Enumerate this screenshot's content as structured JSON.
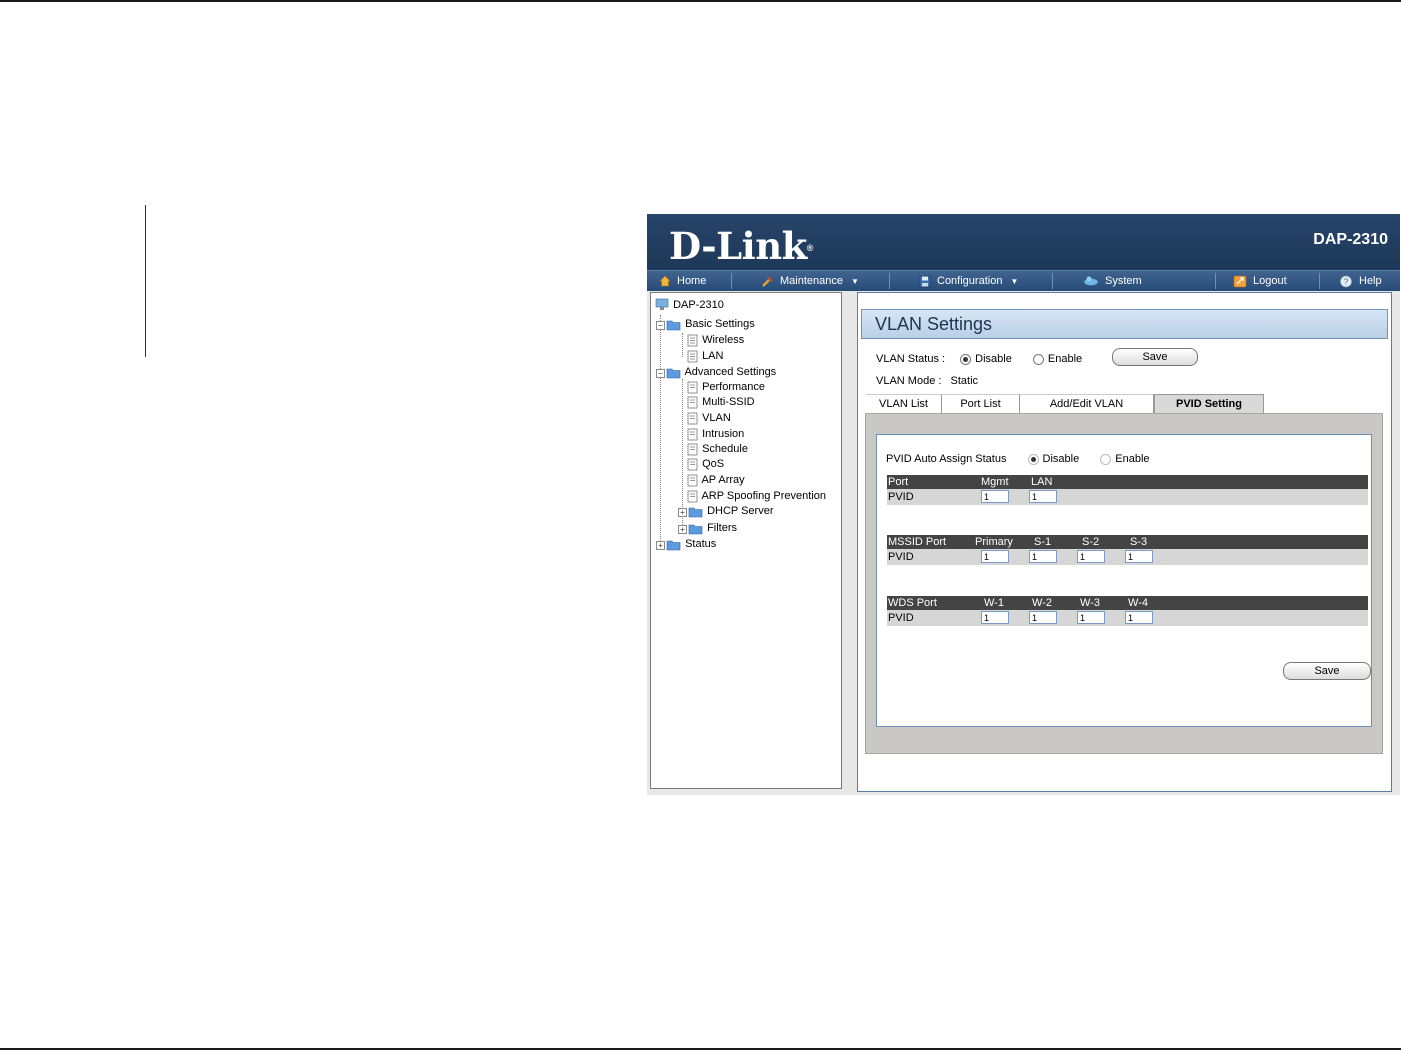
{
  "device": {
    "brand": "D-Link",
    "model": "DAP-2310"
  },
  "menu": [
    {
      "label": "Home",
      "icon": "home-icon"
    },
    {
      "label": "Maintenance",
      "icon": "tools-icon",
      "dropdown": true
    },
    {
      "label": "Configuration",
      "icon": "save-disk-icon",
      "dropdown": true
    },
    {
      "label": "System",
      "icon": "system-icon"
    },
    {
      "label": "Logout",
      "icon": "logout-icon"
    },
    {
      "label": "Help",
      "icon": "help-icon"
    }
  ],
  "tree": {
    "root": "DAP-2310",
    "basic_settings": "Basic Settings",
    "wireless": "Wireless",
    "lan": "LAN",
    "advanced_settings": "Advanced Settings",
    "performance": "Performance",
    "multi_ssid": "Multi-SSID",
    "vlan": "VLAN",
    "intrusion": "Intrusion",
    "schedule": "Schedule",
    "qos": "QoS",
    "ap_array": "AP Array",
    "arp_spoofing": "ARP Spoofing Prevention",
    "dhcp_server": "DHCP Server",
    "filters": "Filters",
    "status": "Status"
  },
  "panel": {
    "title": "VLAN Settings",
    "vlan_status_label": "VLAN Status",
    "vlan_status_sep": ":",
    "disable_label": "Disable",
    "enable_label": "Enable",
    "vlan_status_value": "Disable",
    "save_label": "Save",
    "vlan_mode_label": "VLAN Mode",
    "vlan_mode_sep": ":",
    "vlan_mode_value": "Static"
  },
  "tabs": [
    {
      "label": "VLAN List",
      "active": false
    },
    {
      "label": "Port List",
      "active": false
    },
    {
      "label": "Add/Edit VLAN",
      "active": false
    },
    {
      "label": "PVID Setting",
      "active": true
    }
  ],
  "pvid": {
    "auto_assign_label": "PVID Auto Assign Status",
    "disable_label": "Disable",
    "enable_label": "Enable",
    "auto_assign_value": "Disable",
    "port_table": {
      "headers": [
        "Port",
        "Mgmt",
        "LAN"
      ],
      "row_label": "PVID",
      "values": [
        "1",
        "1"
      ]
    },
    "mssid_table": {
      "headers": [
        "MSSID Port",
        "Primary",
        "S-1",
        "S-2",
        "S-3"
      ],
      "row_label": "PVID",
      "values": [
        "1",
        "1",
        "1",
        "1"
      ]
    },
    "wds_table": {
      "headers": [
        "WDS Port",
        "W-1",
        "W-2",
        "W-3",
        "W-4"
      ],
      "row_label": "PVID",
      "values": [
        "1",
        "1",
        "1",
        "1"
      ]
    },
    "save_label": "Save"
  }
}
